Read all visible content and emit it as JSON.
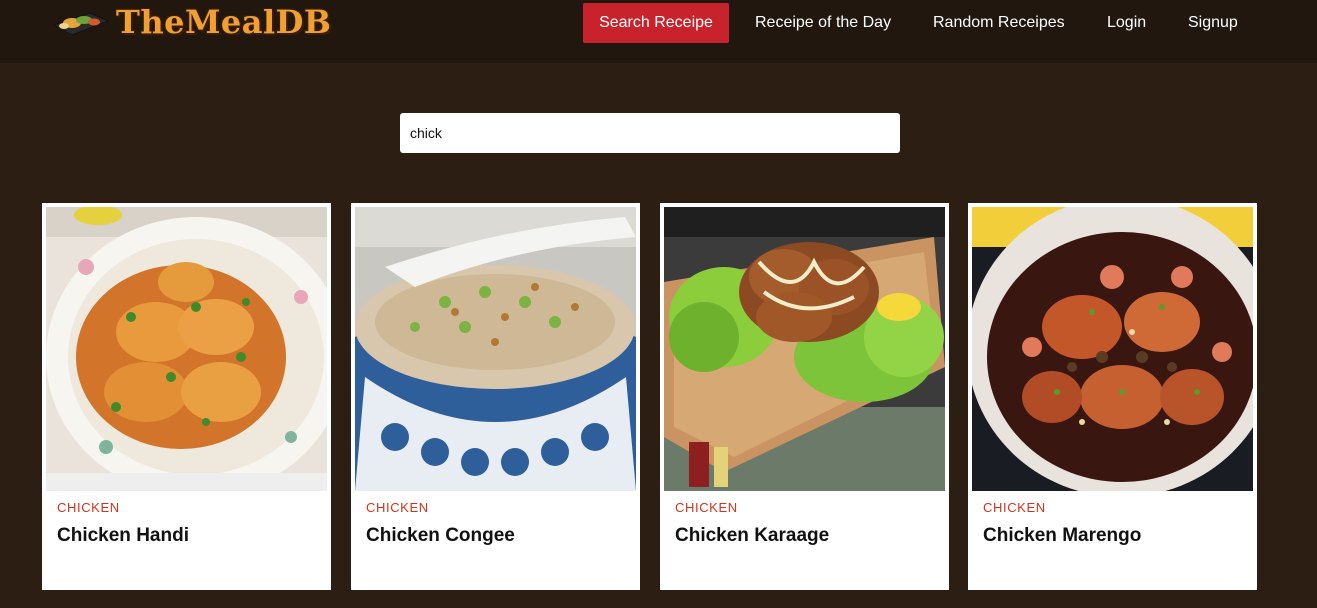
{
  "brand": {
    "name": "TheMealDB"
  },
  "nav": {
    "items": [
      {
        "label": "Search Receipe",
        "active": true
      },
      {
        "label": "Receipe of the Day",
        "active": false
      },
      {
        "label": "Random Receipes",
        "active": false
      },
      {
        "label": "Login",
        "active": false
      },
      {
        "label": "Signup",
        "active": false
      }
    ]
  },
  "search": {
    "value": "chick"
  },
  "colors": {
    "accent": "#c8232c",
    "background": "#2c1e12",
    "navbar": "#21170e",
    "category": "#d4331c"
  },
  "meals": [
    {
      "category": "CHICKEN",
      "title": "Chicken Handi"
    },
    {
      "category": "CHICKEN",
      "title": "Chicken Congee"
    },
    {
      "category": "CHICKEN",
      "title": "Chicken Karaage"
    },
    {
      "category": "CHICKEN",
      "title": "Chicken Marengo"
    }
  ]
}
